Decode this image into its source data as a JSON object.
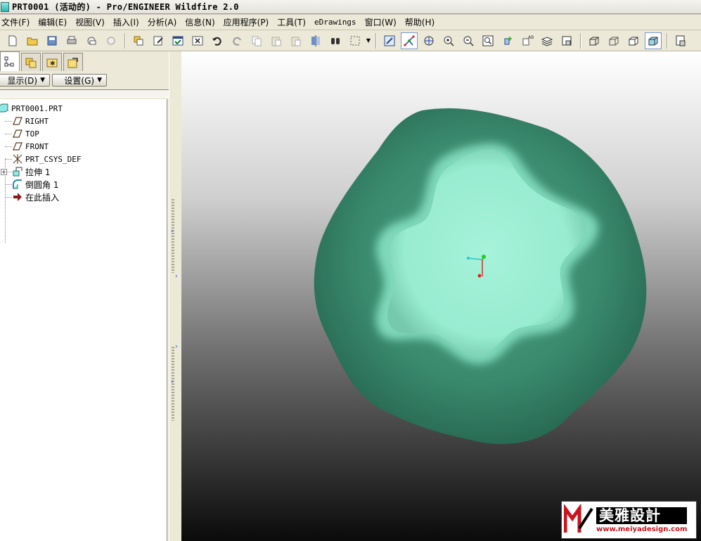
{
  "window": {
    "title": "PRT0001 (活动的) - Pro/ENGINEER Wildfire 2.0"
  },
  "menu": [
    {
      "label": "文件(F)"
    },
    {
      "label": "编辑(E)"
    },
    {
      "label": "视图(V)"
    },
    {
      "label": "插入(I)"
    },
    {
      "label": "分析(A)"
    },
    {
      "label": "信息(N)"
    },
    {
      "label": "应用程序(P)"
    },
    {
      "label": "工具(T)"
    },
    {
      "label": "eDrawings"
    },
    {
      "label": "窗口(W)"
    },
    {
      "label": "帮助(H)"
    }
  ],
  "toolbar": {
    "icons": [
      "new-file-icon",
      "open-folder-icon",
      "save-icon",
      "print-icon",
      "send-mail-icon",
      "send-icon",
      "regenerate-icon",
      "edit-definition-icon",
      "accept-icon",
      "close-window-icon",
      "undo-icon",
      "redo-icon",
      "copy-icon",
      "paste-icon",
      "paste-special-icon",
      "mirror-icon",
      "find-icon",
      "selection-box-icon",
      "repaint-icon",
      "spin-center-icon",
      "orient-mode-icon",
      "zoom-in-icon",
      "zoom-out-icon",
      "refit-icon",
      "reorient-icon",
      "saved-views-icon",
      "layers-icon",
      "view-manager-icon",
      "wireframe-icon",
      "hidden-line-icon",
      "no-hidden-icon",
      "shading-icon",
      "display-settings-icon"
    ]
  },
  "panel": {
    "display_label": "显示(D)",
    "settings_label": "设置(G)",
    "tabs": [
      "model-tree-tab",
      "folder-browser-tab",
      "favorites-tab",
      "connections-tab"
    ]
  },
  "tree": {
    "root": "PRT0001.PRT",
    "items": [
      {
        "label": "RIGHT",
        "icon": "datum-plane-icon"
      },
      {
        "label": "TOP",
        "icon": "datum-plane-icon"
      },
      {
        "label": "FRONT",
        "icon": "datum-plane-icon"
      },
      {
        "label": "PRT_CSYS_DEF",
        "icon": "coordinate-system-icon"
      },
      {
        "label": "拉伸 1",
        "icon": "extrude-icon",
        "expandable": true
      },
      {
        "label": "倒圆角 1",
        "icon": "round-icon"
      },
      {
        "label": "在此插入",
        "icon": "insert-here-arrow-icon"
      }
    ]
  },
  "colors": {
    "model_body": "#3a8a6e",
    "model_top": "#98ecd0",
    "accent_blue": "#1a3cc8"
  },
  "watermark": {
    "title": "美雅設計",
    "url": "www.meiyadesign.com"
  }
}
